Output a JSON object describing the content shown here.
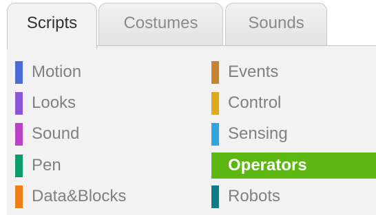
{
  "tabs": [
    {
      "label": "Scripts",
      "active": true
    },
    {
      "label": "Costumes",
      "active": false
    },
    {
      "label": "Sounds",
      "active": false
    }
  ],
  "categories": {
    "left": [
      {
        "label": "Motion",
        "color": "#4a6cd4"
      },
      {
        "label": "Looks",
        "color": "#8a55d7"
      },
      {
        "label": "Sound",
        "color": "#bb42c3"
      },
      {
        "label": "Pen",
        "color": "#0e9a6c"
      },
      {
        "label": "Data&Blocks",
        "color": "#ee7d16"
      }
    ],
    "right": [
      {
        "label": "Events",
        "color": "#c88330"
      },
      {
        "label": "Control",
        "color": "#e1a91a"
      },
      {
        "label": "Sensing",
        "color": "#2ca5e2"
      },
      {
        "label": "Operators",
        "color": "#5cb712",
        "selected": true
      },
      {
        "label": "Robots",
        "color": "#0e7b88"
      }
    ]
  },
  "colors": {
    "selected_bg": "#5cb712",
    "palette_bg": "#f2f2f2",
    "inactive_text": "#808080"
  }
}
